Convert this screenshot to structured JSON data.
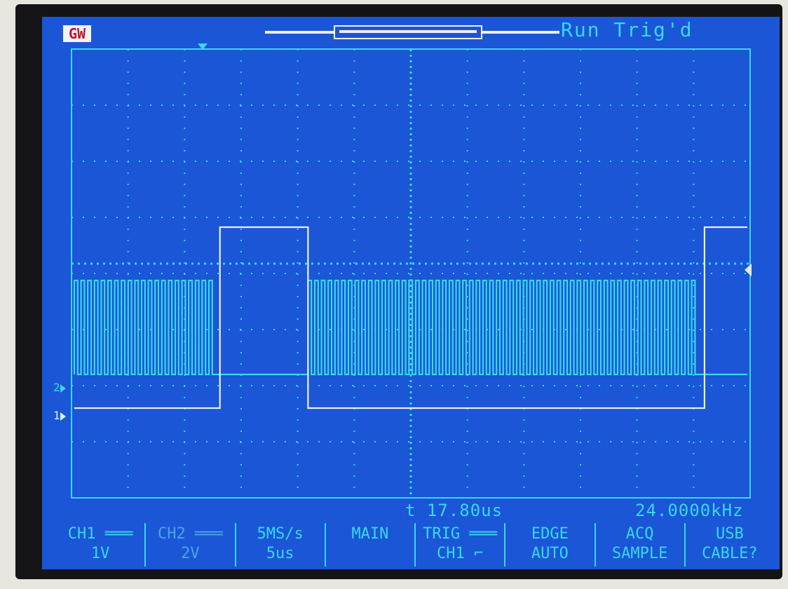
{
  "top": {
    "logo": "GW",
    "status": "Run  Trig'd"
  },
  "channel_markers": {
    "ch1": "1",
    "ch2": "2"
  },
  "readouts": {
    "time": "t 17.80us",
    "frequency": "24.0000kHz"
  },
  "menu": [
    {
      "line1": "CH1 ═══",
      "line2": "1V",
      "name": "ch1-menu"
    },
    {
      "line1": "CH2 ═══",
      "line2": "2V",
      "name": "ch2-menu"
    },
    {
      "line1": "5MS/s",
      "line2": "5us",
      "name": "timebase-menu"
    },
    {
      "line1": "MAIN",
      "line2": "",
      "name": "main-menu"
    },
    {
      "line1": "TRIG ═══",
      "line2": "CH1 ⌐",
      "name": "trig-menu"
    },
    {
      "line1": "EDGE",
      "line2": "AUTO",
      "name": "edge-menu"
    },
    {
      "line1": "ACQ",
      "line2": "SAMPLE",
      "name": "acq-menu"
    },
    {
      "line1": "USB",
      "line2": "CABLE?",
      "name": "usb-menu"
    }
  ],
  "colors": {
    "screen_bg": "#1a56d6",
    "ch2_trace": "#38d8f0",
    "ch1_trace": "#e8f0f8",
    "grid": "#38d8f0"
  },
  "waveforms": {
    "ch1": {
      "description_levels": [
        "low",
        "high",
        "low",
        "high"
      ],
      "high_from_us": [
        [
          11.9,
          19.1
        ],
        [
          51.5,
          55.0
        ]
      ],
      "time_span_us": [
        0,
        55
      ]
    },
    "ch2": {
      "burst_us": [
        [
          0.0,
          11.9
        ],
        [
          19.1,
          51.5
        ]
      ],
      "pulse_period_us": 0.55
    }
  }
}
